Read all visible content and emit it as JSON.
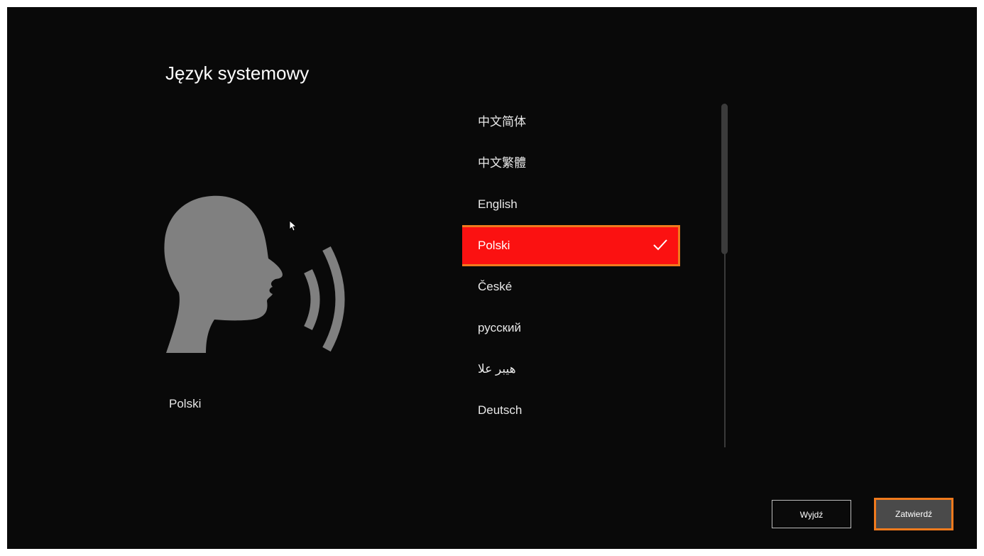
{
  "page": {
    "title": "Język systemowy",
    "current_language": "Polski"
  },
  "languages": [
    {
      "label": "中文简体",
      "selected": false
    },
    {
      "label": "中文繁體",
      "selected": false
    },
    {
      "label": "English",
      "selected": false
    },
    {
      "label": "Polski",
      "selected": true
    },
    {
      "label": "České",
      "selected": false
    },
    {
      "label": "русский",
      "selected": false
    },
    {
      "label": "هيبر علا",
      "selected": false
    },
    {
      "label": "Deutsch",
      "selected": false
    },
    {
      "label": "",
      "selected": false
    }
  ],
  "buttons": {
    "exit_label": "Wyjdź",
    "confirm_label": "Zatwierdź"
  },
  "colors": {
    "background": "#090909",
    "selected_item": "#fb1111",
    "highlight_outline": "#f07a1d",
    "illustration": "#808080",
    "confirm_button": "#4a4a4a"
  },
  "icons": {
    "speaking_head": "speaking-head-icon",
    "selected_check": "check-icon",
    "pointer": "mouse-cursor-icon"
  }
}
